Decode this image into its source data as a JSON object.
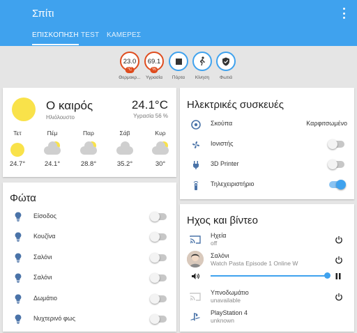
{
  "header": {
    "title": "Σπίτι"
  },
  "tabs": [
    {
      "label": "ΕΠΙΣΚΟΠΗΣΗ"
    },
    {
      "label": "TEST"
    },
    {
      "label": "ΚΑΜΕΡΕΣ"
    }
  ],
  "badges": [
    {
      "value": "23.0",
      "unit": "°C",
      "label": "Θερμοκρ..."
    },
    {
      "value": "69.1",
      "unit": "%",
      "label": "Υγρασία"
    },
    {
      "label": "Πόρτα",
      "icon": "stop-square-icon"
    },
    {
      "label": "Κίνηση",
      "icon": "walking-person-icon"
    },
    {
      "label": "Φωτιά",
      "icon": "shield-icon"
    }
  ],
  "weather": {
    "title": "Ο καιρός",
    "condition": "Ηλιόλουστο",
    "temperature": "24.1°C",
    "humidity": "Υγρασία 56 %",
    "forecast": [
      {
        "day": "Τετ",
        "temp": "24.7°",
        "icon": "sunny"
      },
      {
        "day": "Πέμ",
        "temp": "24.1°",
        "icon": "partly-cloudy"
      },
      {
        "day": "Παρ",
        "temp": "28.8°",
        "icon": "partly-cloudy"
      },
      {
        "day": "Σάβ",
        "temp": "35.2°",
        "icon": "cloudy"
      },
      {
        "day": "Κυρ",
        "temp": "30°",
        "icon": "partly-cloudy"
      }
    ]
  },
  "lights": {
    "title": "Φώτα",
    "items": [
      {
        "label": "Είσοδος",
        "on": false
      },
      {
        "label": "Κουζίνα",
        "on": false
      },
      {
        "label": "Σαλόνι",
        "on": false
      },
      {
        "label": "Σαλόνι",
        "on": false
      },
      {
        "label": "Δωμάτιο",
        "on": false
      },
      {
        "label": "Νυχτερινό φως",
        "on": false
      }
    ]
  },
  "devices": {
    "title": "Ηλεκτρικές συσκευές",
    "items": [
      {
        "label": "Σκούπα",
        "state": "Καρφιτσωμένο",
        "icon": "robot-vacuum-icon"
      },
      {
        "label": "Ιονιστής",
        "on": false,
        "icon": "fan-icon"
      },
      {
        "label": "3D Printer",
        "on": false,
        "icon": "power-plug-icon"
      },
      {
        "label": "Τηλεχειριστήριο",
        "on": true,
        "icon": "remote-icon"
      }
    ]
  },
  "media": {
    "title": "Ηχος και βίντεο",
    "players": [
      {
        "name": "Ηχεία",
        "status": "off",
        "icon": "cast-icon"
      },
      {
        "name": "Σαλόνι",
        "status": "Watch Pasta Episode 1 Online W",
        "icon": "avatar"
      },
      {
        "name": "Υπνοδωμάτιο",
        "status": "unavailable",
        "icon": "cast-icon"
      },
      {
        "name": "PlayStation 4",
        "status": "unknown",
        "icon": "playstation-icon"
      }
    ],
    "volume": 1.0
  },
  "colors": {
    "accent": "#3fa2ee",
    "badge_alert": "#df4c1e",
    "sun": "#f9e24a"
  }
}
